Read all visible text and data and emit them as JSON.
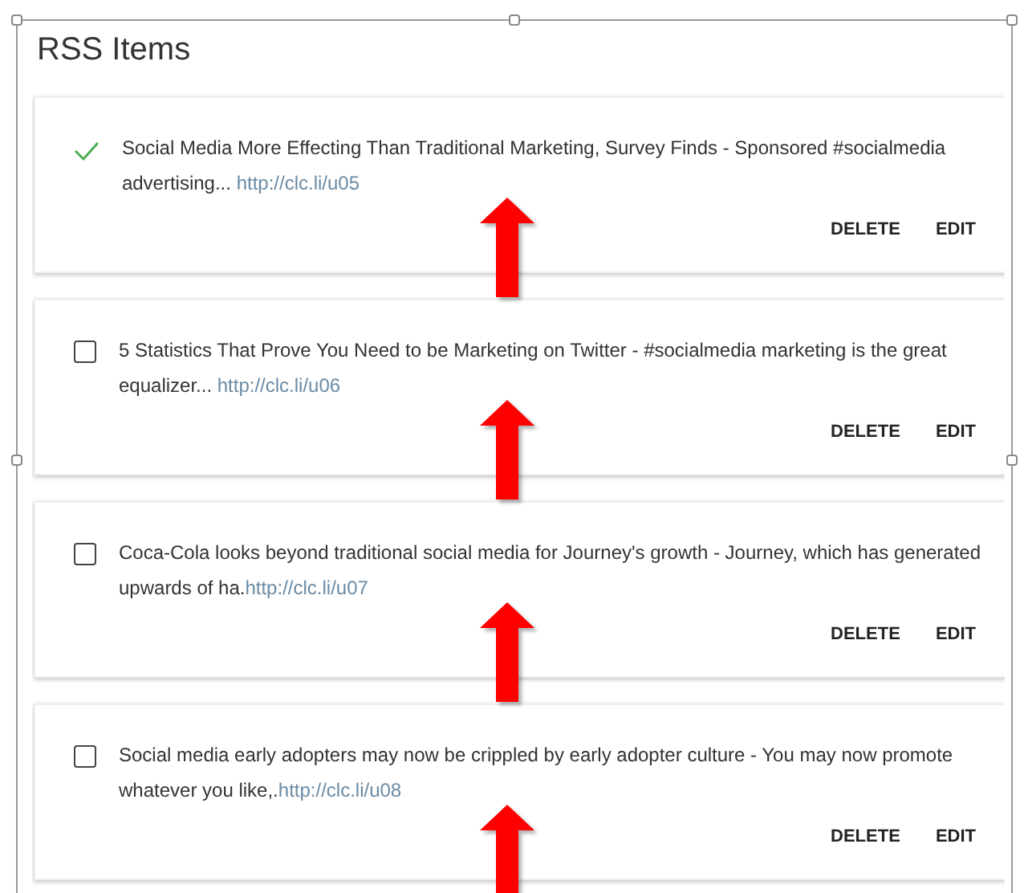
{
  "panel": {
    "title": "RSS Items"
  },
  "items": [
    {
      "checked": true,
      "text": "Social Media More Effecting Than Traditional Marketing, Survey Finds - Sponsored #socialmedia advertising... ",
      "link": "http://clc.li/u05",
      "annotated": true,
      "actions": [
        "DELETE",
        "EDIT"
      ]
    },
    {
      "checked": false,
      "text": "5 Statistics That Prove You Need to be Marketing on Twitter - #socialmedia marketing is the great equalizer... ",
      "link": "http://clc.li/u06",
      "annotated": true,
      "actions": [
        "DELETE",
        "EDIT"
      ]
    },
    {
      "checked": false,
      "text": "Coca-Cola looks beyond traditional social media for Journey's growth - Journey, which has generated upwards of ha.",
      "link": "http://clc.li/u07",
      "annotated": true,
      "actions": [
        "DELETE",
        "EDIT"
      ]
    },
    {
      "checked": false,
      "text": "Social media early adopters may now be crippled by early adopter culture - You may now promote whatever you like,.",
      "link": "http://clc.li/u08",
      "annotated": true,
      "actions": [
        "DELETE",
        "EDIT"
      ]
    }
  ]
}
